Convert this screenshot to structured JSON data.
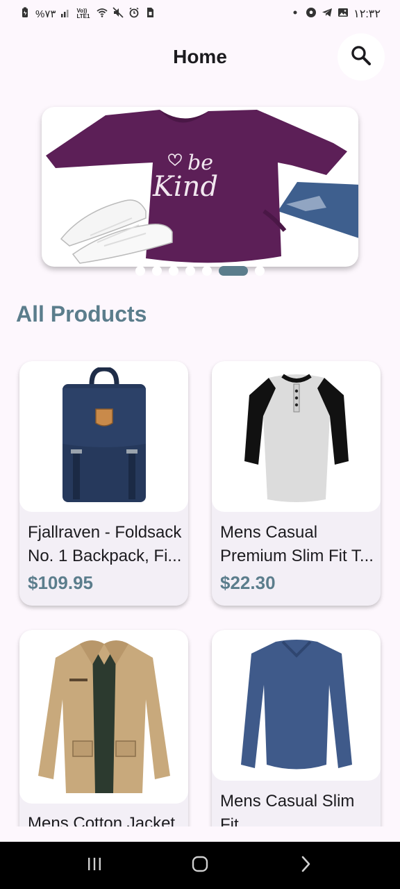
{
  "status_bar": {
    "battery": "%۷۳",
    "volte": "Vo)) LTE1",
    "time": "۱۲:۳۲"
  },
  "app_bar": {
    "title": "Home",
    "search_icon": "search-icon"
  },
  "banner": {
    "image": "be Kind t-shirt with sneakers and jeans",
    "shirt_text_line1": "be",
    "shirt_text_line2": "Kind",
    "dot_count": 7,
    "active_dot": 5
  },
  "section": {
    "title": "All Products"
  },
  "products": [
    {
      "name": "Fjallraven - Foldsack No. 1 Backpack, Fi...",
      "price": "$109.95",
      "image": "backpack"
    },
    {
      "name": "Mens Casual Premium Slim Fit T...",
      "price": "$22.30",
      "image": "raglan-henley-shirt"
    },
    {
      "name": "Mens Cotton Jacket",
      "price": "",
      "image": "cotton-jacket"
    },
    {
      "name": "Mens Casual Slim Fit",
      "price": "",
      "image": "long-sleeve-tee"
    }
  ],
  "nav": {
    "recents": "recents-icon",
    "home": "home-icon",
    "back": "back-icon"
  },
  "colors": {
    "accent": "#5b7d8c",
    "background": "#fdf7fd",
    "card": "#f3eff6"
  }
}
